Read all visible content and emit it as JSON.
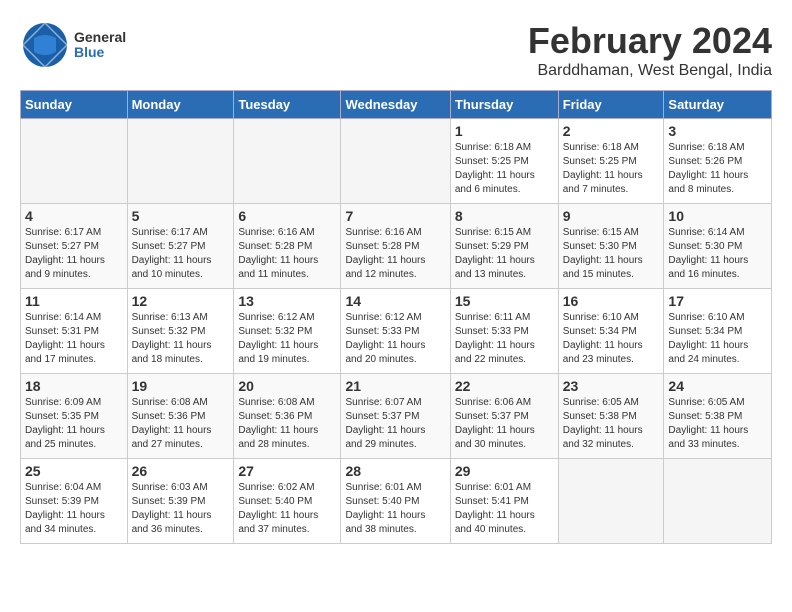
{
  "header": {
    "logo_general": "General",
    "logo_blue": "Blue",
    "month_title": "February 2024",
    "subtitle": "Barddhaman, West Bengal, India"
  },
  "days_of_week": [
    "Sunday",
    "Monday",
    "Tuesday",
    "Wednesday",
    "Thursday",
    "Friday",
    "Saturday"
  ],
  "weeks": [
    [
      {
        "day": "",
        "info": ""
      },
      {
        "day": "",
        "info": ""
      },
      {
        "day": "",
        "info": ""
      },
      {
        "day": "",
        "info": ""
      },
      {
        "day": "1",
        "info": "Sunrise: 6:18 AM\nSunset: 5:25 PM\nDaylight: 11 hours\nand 6 minutes."
      },
      {
        "day": "2",
        "info": "Sunrise: 6:18 AM\nSunset: 5:25 PM\nDaylight: 11 hours\nand 7 minutes."
      },
      {
        "day": "3",
        "info": "Sunrise: 6:18 AM\nSunset: 5:26 PM\nDaylight: 11 hours\nand 8 minutes."
      }
    ],
    [
      {
        "day": "4",
        "info": "Sunrise: 6:17 AM\nSunset: 5:27 PM\nDaylight: 11 hours\nand 9 minutes."
      },
      {
        "day": "5",
        "info": "Sunrise: 6:17 AM\nSunset: 5:27 PM\nDaylight: 11 hours\nand 10 minutes."
      },
      {
        "day": "6",
        "info": "Sunrise: 6:16 AM\nSunset: 5:28 PM\nDaylight: 11 hours\nand 11 minutes."
      },
      {
        "day": "7",
        "info": "Sunrise: 6:16 AM\nSunset: 5:28 PM\nDaylight: 11 hours\nand 12 minutes."
      },
      {
        "day": "8",
        "info": "Sunrise: 6:15 AM\nSunset: 5:29 PM\nDaylight: 11 hours\nand 13 minutes."
      },
      {
        "day": "9",
        "info": "Sunrise: 6:15 AM\nSunset: 5:30 PM\nDaylight: 11 hours\nand 15 minutes."
      },
      {
        "day": "10",
        "info": "Sunrise: 6:14 AM\nSunset: 5:30 PM\nDaylight: 11 hours\nand 16 minutes."
      }
    ],
    [
      {
        "day": "11",
        "info": "Sunrise: 6:14 AM\nSunset: 5:31 PM\nDaylight: 11 hours\nand 17 minutes."
      },
      {
        "day": "12",
        "info": "Sunrise: 6:13 AM\nSunset: 5:32 PM\nDaylight: 11 hours\nand 18 minutes."
      },
      {
        "day": "13",
        "info": "Sunrise: 6:12 AM\nSunset: 5:32 PM\nDaylight: 11 hours\nand 19 minutes."
      },
      {
        "day": "14",
        "info": "Sunrise: 6:12 AM\nSunset: 5:33 PM\nDaylight: 11 hours\nand 20 minutes."
      },
      {
        "day": "15",
        "info": "Sunrise: 6:11 AM\nSunset: 5:33 PM\nDaylight: 11 hours\nand 22 minutes."
      },
      {
        "day": "16",
        "info": "Sunrise: 6:10 AM\nSunset: 5:34 PM\nDaylight: 11 hours\nand 23 minutes."
      },
      {
        "day": "17",
        "info": "Sunrise: 6:10 AM\nSunset: 5:34 PM\nDaylight: 11 hours\nand 24 minutes."
      }
    ],
    [
      {
        "day": "18",
        "info": "Sunrise: 6:09 AM\nSunset: 5:35 PM\nDaylight: 11 hours\nand 25 minutes."
      },
      {
        "day": "19",
        "info": "Sunrise: 6:08 AM\nSunset: 5:36 PM\nDaylight: 11 hours\nand 27 minutes."
      },
      {
        "day": "20",
        "info": "Sunrise: 6:08 AM\nSunset: 5:36 PM\nDaylight: 11 hours\nand 28 minutes."
      },
      {
        "day": "21",
        "info": "Sunrise: 6:07 AM\nSunset: 5:37 PM\nDaylight: 11 hours\nand 29 minutes."
      },
      {
        "day": "22",
        "info": "Sunrise: 6:06 AM\nSunset: 5:37 PM\nDaylight: 11 hours\nand 30 minutes."
      },
      {
        "day": "23",
        "info": "Sunrise: 6:05 AM\nSunset: 5:38 PM\nDaylight: 11 hours\nand 32 minutes."
      },
      {
        "day": "24",
        "info": "Sunrise: 6:05 AM\nSunset: 5:38 PM\nDaylight: 11 hours\nand 33 minutes."
      }
    ],
    [
      {
        "day": "25",
        "info": "Sunrise: 6:04 AM\nSunset: 5:39 PM\nDaylight: 11 hours\nand 34 minutes."
      },
      {
        "day": "26",
        "info": "Sunrise: 6:03 AM\nSunset: 5:39 PM\nDaylight: 11 hours\nand 36 minutes."
      },
      {
        "day": "27",
        "info": "Sunrise: 6:02 AM\nSunset: 5:40 PM\nDaylight: 11 hours\nand 37 minutes."
      },
      {
        "day": "28",
        "info": "Sunrise: 6:01 AM\nSunset: 5:40 PM\nDaylight: 11 hours\nand 38 minutes."
      },
      {
        "day": "29",
        "info": "Sunrise: 6:01 AM\nSunset: 5:41 PM\nDaylight: 11 hours\nand 40 minutes."
      },
      {
        "day": "",
        "info": ""
      },
      {
        "day": "",
        "info": ""
      }
    ]
  ]
}
